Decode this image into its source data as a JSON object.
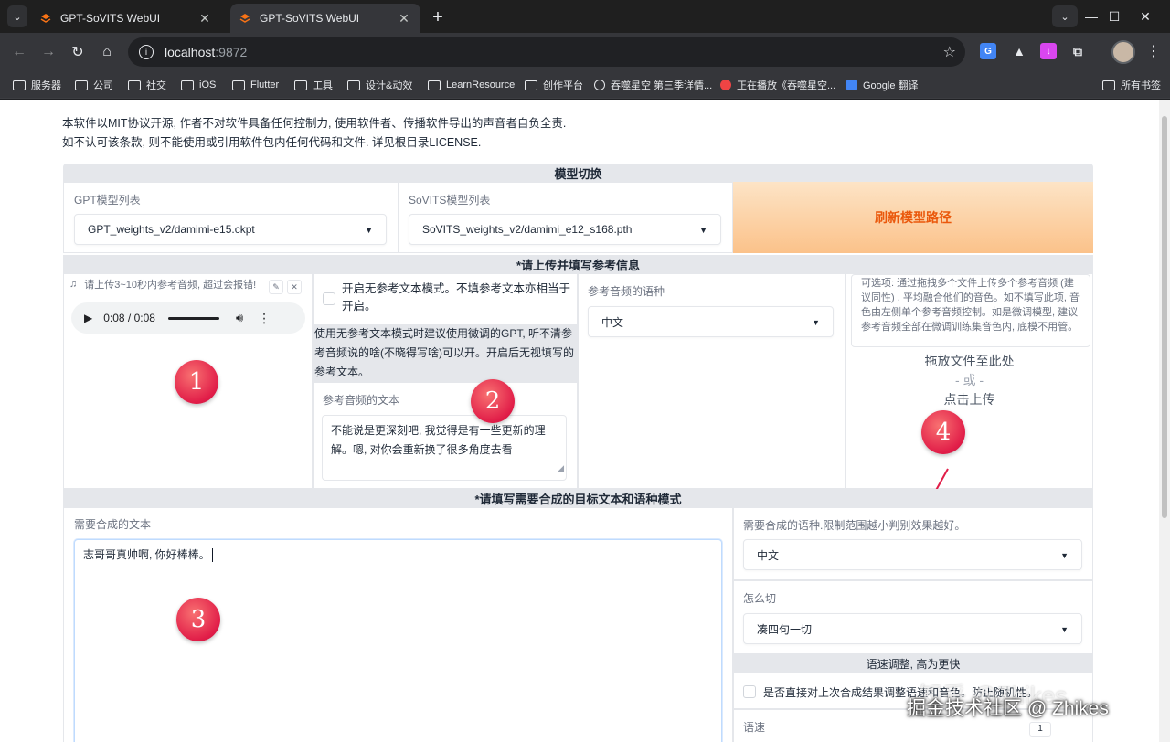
{
  "browser": {
    "tabs": [
      {
        "title": "GPT-SoVITS WebUI",
        "active": false
      },
      {
        "title": "GPT-SoVITS WebUI",
        "active": true
      }
    ],
    "url_host": "localhost",
    "url_port": ":9872",
    "bookmarks": [
      "服务器",
      "公司",
      "社交",
      "iOS",
      "Flutter",
      "工具",
      "设计&动效",
      "LearnResource",
      "创作平台",
      "吞噬星空 第三季详情...",
      "正在播放《吞噬星空...",
      "Google 翻译"
    ],
    "all_bookmarks": "所有书签"
  },
  "notice": {
    "line1": "本软件以MIT协议开源, 作者不对软件具备任何控制力, 使用软件者、传播软件导出的声音者自负全责.",
    "line2": "如不认可该条款, 则不能使用或引用软件包内任何代码和文件. 详见根目录LICENSE."
  },
  "model_switch": {
    "header": "模型切换",
    "gpt_label": "GPT模型列表",
    "gpt_value": "GPT_weights_v2/damimi-e15.ckpt",
    "sovits_label": "SoVITS模型列表",
    "sovits_value": "SoVITS_weights_v2/damimi_e12_s168.pth",
    "refresh_label": "刷新模型路径"
  },
  "reference": {
    "header": "*请上传并填写参考信息",
    "audio_label": "请上传3~10秒内参考音频, 超过会报错!",
    "audio_time": "0:08 / 0:08",
    "no_ref_mode_label": "开启无参考文本模式。不填参考文本亦相当于开启。",
    "no_ref_info": "使用无参考文本模式时建议使用微调的GPT, 听不清参考音频说的啥(不晓得写啥)可以开。开启后无视填写的参考文本。",
    "ref_text_label": "参考音频的文本",
    "ref_text_value": "不能说是更深刻吧, 我觉得是有一些更新的理解。嗯, 对你会重新换了很多角度去看",
    "ref_lang_label": "参考音频的语种",
    "ref_lang_value": "中文",
    "multi_ref_hint": "可选项: 通过拖拽多个文件上传多个参考音频 (建议同性) , 平均融合他们的音色。如不填写此项, 音色由左侧单个参考音频控制。如是微调模型, 建议参考音频全部在微调训练集音色内, 底模不用管。",
    "dropzone_line1": "拖放文件至此处",
    "dropzone_or": "- 或 -",
    "dropzone_line2": "点击上传"
  },
  "target": {
    "header": "*请填写需要合成的目标文本和语种模式",
    "text_label": "需要合成的文本",
    "text_value": "志哥哥真帅啊, 你好棒棒。",
    "lang_label": "需要合成的语种.限制范围越小判别效果越好。",
    "lang_value": "中文",
    "split_label": "怎么切",
    "split_value": "凑四句一切",
    "speed_header": "语速调整, 高为更快",
    "speed_checkbox_label": "是否直接对上次合成结果调整语速和音色。防止随机性。",
    "speed_label": "语速",
    "speed_value": "1"
  },
  "badges": [
    "1",
    "2",
    "3",
    "4"
  ],
  "watermark": {
    "text": "掘金技术社区 @ Zhikes",
    "ghost": "知乎 @Zhikes"
  },
  "colors": {
    "accent_orange": "#ea580c",
    "badge_red": "#e11d48",
    "header_grey": "#e5e7eb"
  }
}
